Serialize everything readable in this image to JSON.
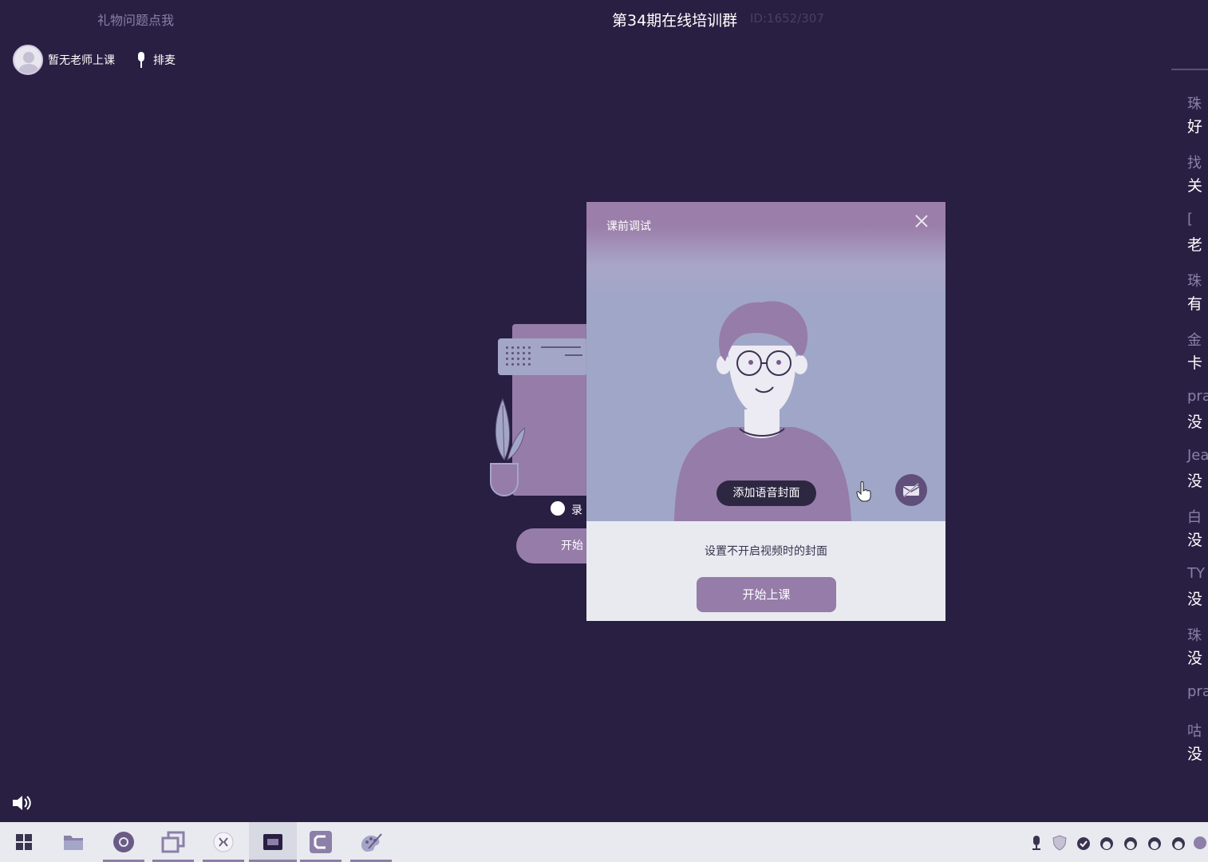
{
  "header": {
    "gift_link": "礼物问题点我",
    "room_title": "第34期在线培训群",
    "room_id": "ID:1652/307"
  },
  "teacher_bar": {
    "teacher_status": "暂无老师上课",
    "queue_label": "排麦"
  },
  "background_panel": {
    "radio_label": "录",
    "start_label": "开始"
  },
  "dialog": {
    "title": "课前调试",
    "add_cover_label": "添加语音封面",
    "cover_hint": "设置不开启视频时的封面",
    "start_class_label": "开始上课"
  },
  "chat": {
    "messages": [
      {
        "name": "珠",
        "text": "好"
      },
      {
        "name": "找",
        "text": "关"
      },
      {
        "name": "[",
        "text": "老"
      },
      {
        "name": "珠",
        "text": "有"
      },
      {
        "name": "金",
        "text": "卡"
      },
      {
        "name": "pra",
        "text": "没"
      },
      {
        "name": "Jea",
        "text": "没"
      },
      {
        "name": "白",
        "text": "没"
      },
      {
        "name": "TY",
        "text": "没"
      },
      {
        "name": "珠",
        "text": "没"
      },
      {
        "name": "pra",
        "text": ""
      },
      {
        "name": "咕",
        "text": "没"
      }
    ]
  },
  "taskbar": {
    "apps": [
      "start-menu",
      "file-explorer",
      "browser",
      "window-manager",
      "chat-app",
      "classroom-app",
      "capture-app",
      "paint-app"
    ],
    "active_app": "classroom-app"
  },
  "colors": {
    "background": "#281f42",
    "accent": "#967ca9",
    "dialog_bg": "#e8eaf0",
    "preview_bg": "#a0a6c8"
  }
}
